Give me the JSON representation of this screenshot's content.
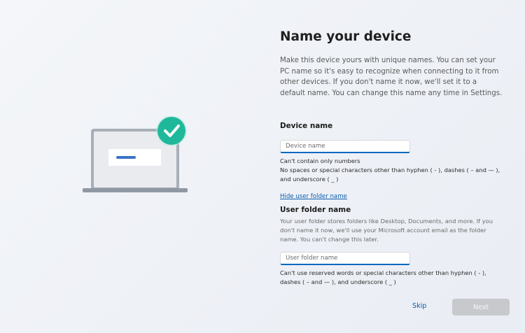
{
  "page": {
    "title": "Name your device",
    "description": "Make this device yours with unique names. You can set your PC name so it's easy to recognize when connecting to it from other devices. If you don't name it now, we'll set it to a default name. You can change this name any time in Settings."
  },
  "device_name": {
    "label": "Device name",
    "value": "",
    "placeholder": "Device name",
    "rules": [
      "Can't contain only numbers",
      "No spaces or special characters other than hyphen ( - ), dashes ( – and — ), and underscore ( _ )"
    ]
  },
  "toggle_link": "Hide user folder name",
  "user_folder": {
    "label": "User folder name",
    "description": "Your user folder stores folders like Desktop, Documents, and more. If you don't name it now, we'll use your Microsoft account email as the folder name. You can't change this later.",
    "value": "",
    "placeholder": "User folder name",
    "rules": "Can't use reserved words or special characters other than hyphen ( - ), dashes ( – and — ), and underscore ( _ )"
  },
  "actions": {
    "skip": "Skip",
    "next": "Next"
  },
  "colors": {
    "accent": "#0067c0",
    "link": "#0b5cad",
    "check_badge": "#1fb89a",
    "disabled_button": "#c7c9cc"
  },
  "icons": {
    "illustration": "laptop-icon",
    "badge": "checkmark-icon"
  }
}
